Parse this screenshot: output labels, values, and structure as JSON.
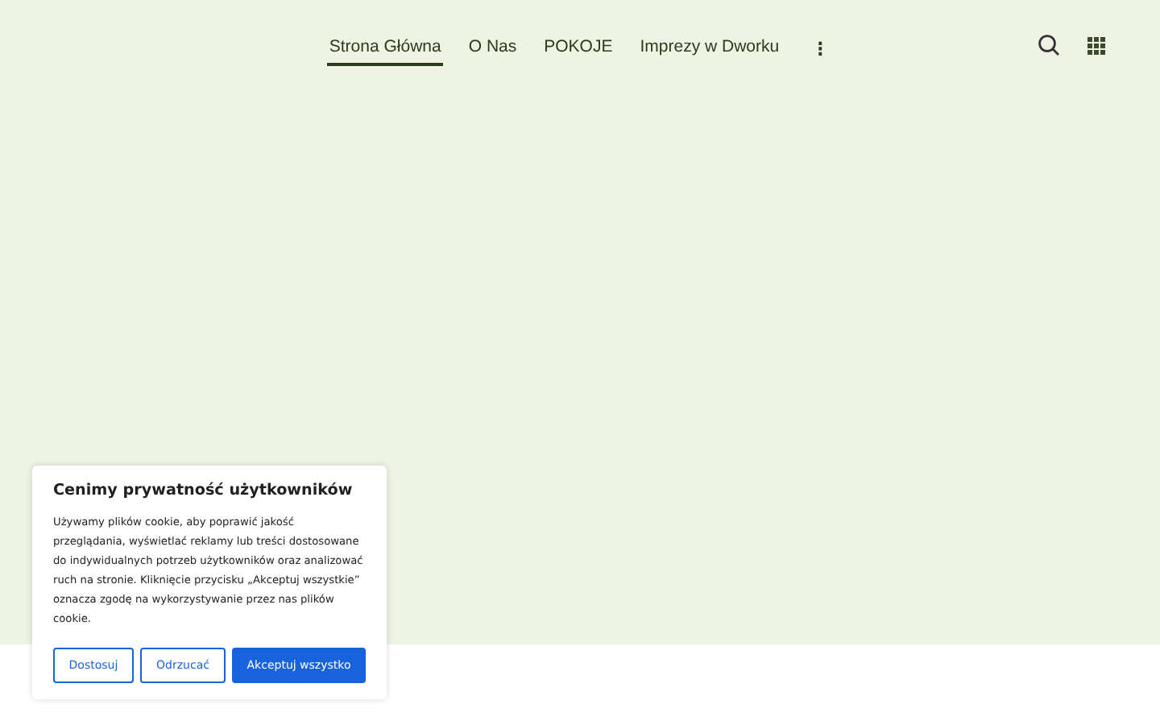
{
  "nav": {
    "items": [
      {
        "label": "Strona Główna",
        "selected": true
      },
      {
        "label": "O Nas",
        "selected": false
      },
      {
        "label": "POKOJE",
        "selected": false
      },
      {
        "label": "Imprezy w Dworku",
        "selected": false
      }
    ],
    "more": "⋮"
  },
  "cookie_banner": {
    "title": "Cenimy prywatność użytkowników",
    "text": "Używamy plików cookie, aby poprawić jakość przeglądania, wyświetlać reklamy lub treści dostosowane do indywidualnych potrzeb użytkowników oraz analizować ruch na stronie. Kliknięcie przycisku „Akceptuj wszystkie” oznacza zgodę na wykorzystywanie przez nas plików cookie.",
    "buttons": [
      {
        "label": "Dostosuj",
        "kind": "outline"
      },
      {
        "label": "Odrzucać",
        "kind": "outline"
      },
      {
        "label": "Akceptuj wszystko",
        "kind": "primary"
      }
    ]
  }
}
